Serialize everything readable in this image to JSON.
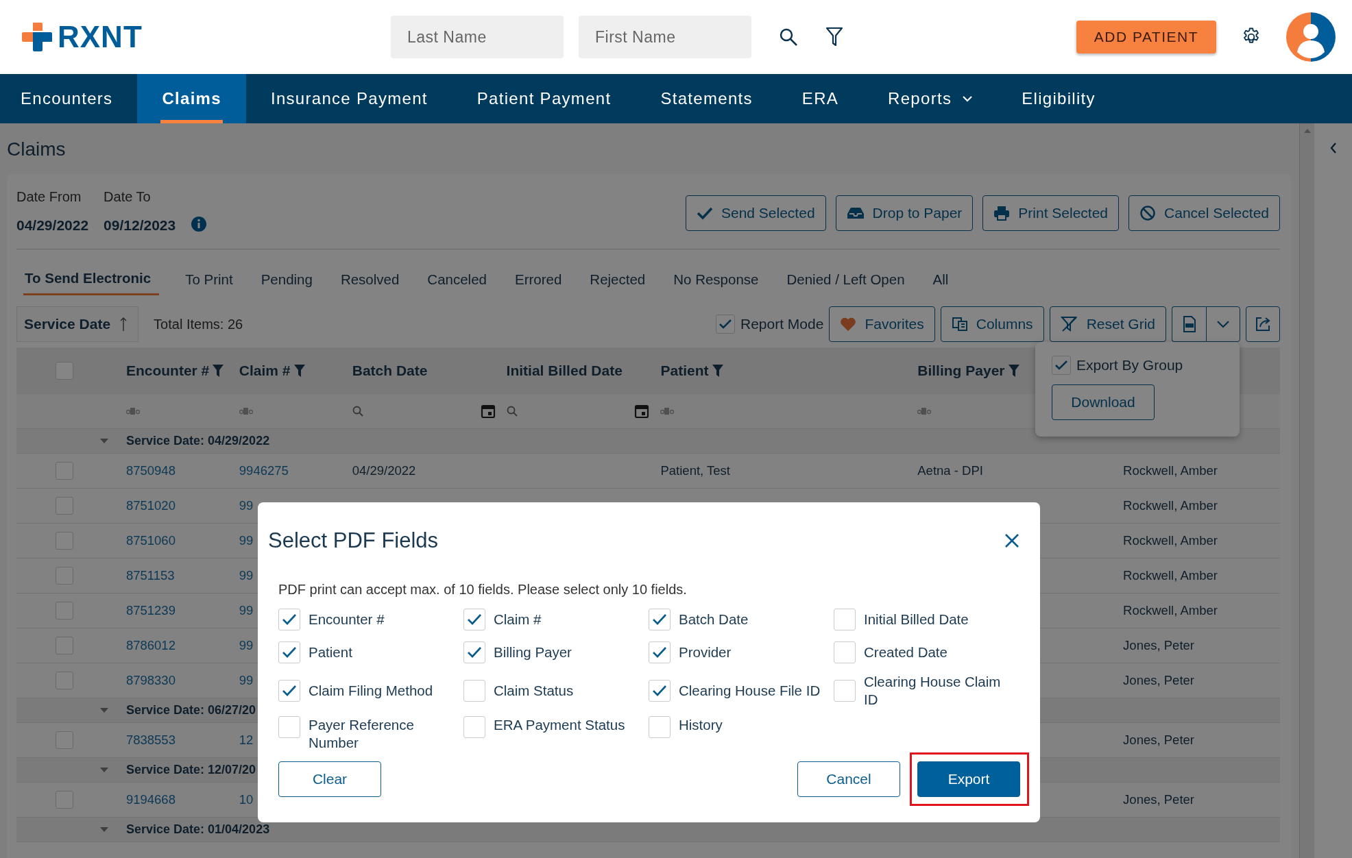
{
  "header": {
    "logo": "RXNT",
    "search_fields": [
      {
        "placeholder": "Last Name"
      },
      {
        "placeholder": "First Name"
      }
    ],
    "add_patient": "ADD PATIENT"
  },
  "nav": [
    {
      "label": "Encounters",
      "selected": false,
      "dropdown": false
    },
    {
      "label": "Claims",
      "selected": true,
      "dropdown": false
    },
    {
      "label": "Insurance Payment",
      "selected": false,
      "dropdown": false
    },
    {
      "label": "Patient Payment",
      "selected": false,
      "dropdown": false
    },
    {
      "label": "Statements",
      "selected": false,
      "dropdown": false
    },
    {
      "label": "ERA",
      "selected": false,
      "dropdown": false
    },
    {
      "label": "Reports",
      "selected": false,
      "dropdown": true
    },
    {
      "label": "Eligibility",
      "selected": false,
      "dropdown": false
    }
  ],
  "page_title": "Claims",
  "dates": [
    {
      "label": "Date From",
      "value": "04/29/2022"
    },
    {
      "label": "Date To",
      "value": "09/12/2023"
    }
  ],
  "actions": [
    {
      "label": "Send Selected",
      "kind": "send"
    },
    {
      "label": "Drop to Paper",
      "kind": "paper"
    },
    {
      "label": "Print Selected",
      "kind": "print"
    },
    {
      "label": "Cancel Selected",
      "kind": "cancel"
    }
  ],
  "tabs": [
    {
      "label": "To Send Electronic",
      "selected": true
    },
    {
      "label": "To Print",
      "selected": false
    },
    {
      "label": "Pending",
      "selected": false
    },
    {
      "label": "Resolved",
      "selected": false
    },
    {
      "label": "Canceled",
      "selected": false
    },
    {
      "label": "Errored",
      "selected": false
    },
    {
      "label": "Rejected",
      "selected": false
    },
    {
      "label": "No Response",
      "selected": false
    },
    {
      "label": "Denied / Left Open",
      "selected": false
    },
    {
      "label": "All",
      "selected": false
    }
  ],
  "sort": {
    "label": "Service Date"
  },
  "total": "Total Items: 26",
  "report_mode": {
    "label": "Report Mode",
    "checked": true
  },
  "tools": [
    {
      "label": "Favorites",
      "kind": "favorites"
    },
    {
      "label": "Columns",
      "kind": "columns"
    },
    {
      "label": "Reset Grid",
      "kind": "reset"
    }
  ],
  "export_menu": {
    "label": "Export By Group",
    "checked": true,
    "button": "Download"
  },
  "table": {
    "select_all": false,
    "columns": [
      {
        "label": "Encounter #",
        "filter": true,
        "kind": "text"
      },
      {
        "label": "Claim #",
        "filter": true,
        "kind": "text"
      },
      {
        "label": "Batch Date",
        "filter": false,
        "kind": "date"
      },
      {
        "label": "Initial Billed Date",
        "filter": false,
        "kind": "date"
      },
      {
        "label": "Patient",
        "filter": true,
        "kind": "text"
      },
      {
        "label": "Billing Payer",
        "filter": true,
        "kind": "text"
      },
      {
        "kind": "hidden"
      }
    ],
    "groups": [
      {
        "label": "Service Date: 04/29/2022",
        "rows": [
          {
            "checked": false,
            "kind": "full",
            "cells": [
              "8750948",
              "9946275",
              "04/29/2022",
              "Patient, Test",
              "Aetna - DPI",
              "Rockwell, Amber"
            ]
          },
          {
            "checked": false,
            "kind": "covered",
            "cells": [
              "8751020",
              "99",
              "Rockwell, Amber"
            ]
          },
          {
            "checked": false,
            "kind": "covered",
            "cells": [
              "8751060",
              "99",
              "Rockwell, Amber"
            ]
          },
          {
            "checked": false,
            "kind": "covered",
            "cells": [
              "8751153",
              "99",
              "Rockwell, Amber"
            ]
          },
          {
            "checked": false,
            "kind": "covered",
            "cells": [
              "8751239",
              "99",
              "Rockwell, Amber"
            ]
          },
          {
            "checked": false,
            "kind": "covered",
            "cells": [
              "8786012",
              "99",
              "Jones, Peter"
            ]
          },
          {
            "checked": false,
            "kind": "covered",
            "cells": [
              "8798330",
              "99",
              "Jones, Peter"
            ]
          }
        ]
      },
      {
        "label": "Service Date: 06/27/20",
        "rows": [
          {
            "checked": false,
            "kind": "covered",
            "cells": [
              "7838553",
              "12",
              "Jones, Peter"
            ]
          }
        ]
      },
      {
        "label": "Service Date: 12/07/20",
        "rows": [
          {
            "checked": false,
            "kind": "covered",
            "cells": [
              "9194668",
              "10",
              "Jones, Peter"
            ]
          }
        ]
      },
      {
        "label": "Service Date: 01/04/2023"
      }
    ]
  },
  "dialog": {
    "title": "Select PDF Fields",
    "note": "PDF print can accept max. of 10 fields. Please select only 10 fields.",
    "fields": [
      {
        "label": "Encounter #",
        "checked": true
      },
      {
        "label": "Claim #",
        "checked": true
      },
      {
        "label": "Batch Date",
        "checked": true
      },
      {
        "label": "Initial Billed Date",
        "checked": false
      },
      {
        "label": "Patient",
        "checked": true
      },
      {
        "label": "Billing Payer",
        "checked": true
      },
      {
        "label": "Provider",
        "checked": true
      },
      {
        "label": "Created Date",
        "checked": false
      },
      {
        "label": "Claim Filing Method",
        "checked": true
      },
      {
        "label": "Claim Status",
        "checked": false
      },
      {
        "label": "Clearing House File ID",
        "checked": true
      },
      {
        "label": "Clearing House Claim ID",
        "checked": false
      },
      {
        "label": "Payer Reference Number",
        "checked": false
      },
      {
        "label": "ERA Payment Status",
        "checked": false
      },
      {
        "label": "History",
        "checked": false
      }
    ],
    "buttons": [
      {
        "label": "Clear",
        "kind": "secondary",
        "highlighted": false
      },
      {
        "label": "Cancel",
        "kind": "secondary",
        "highlighted": false
      },
      {
        "label": "Export",
        "kind": "primary",
        "highlighted": true
      }
    ]
  }
}
